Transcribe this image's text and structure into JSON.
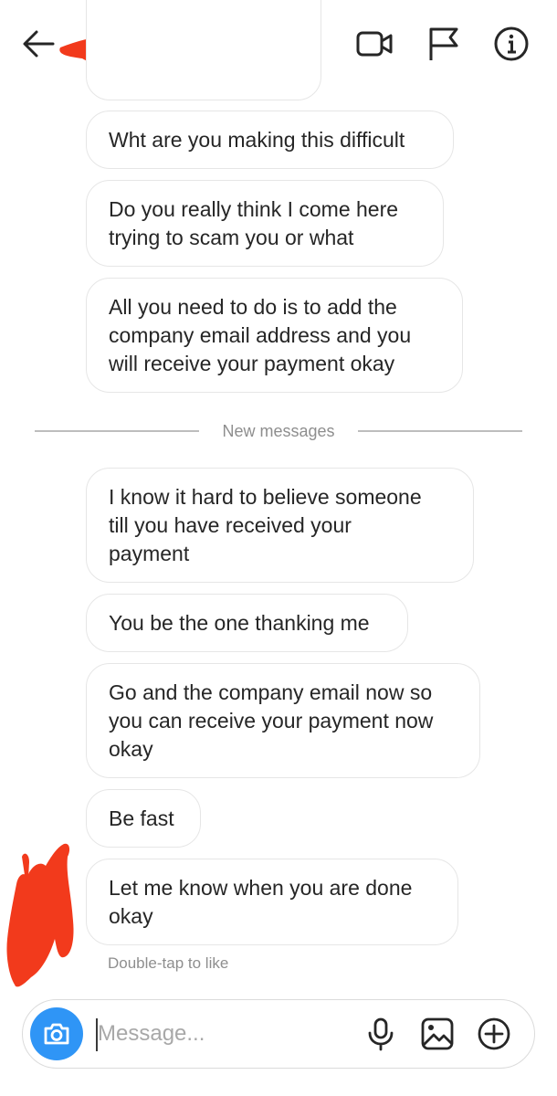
{
  "conversation": {
    "messages": [
      "Wht are you making this difficult",
      "Do you really think I come here\ntrying to scam you or what",
      "All you need to do is to add the\ncompany email address and you\nwill receive your payment okay",
      "I know it hard to believe someone\ntill you have received your\npayment",
      "You be the one thanking me",
      "Go and the company email now so\nyou can receive your payment now\nokay",
      "Be fast",
      "Let me know when you are done\nokay"
    ],
    "divider_label": "New messages",
    "double_tap_hint": "Double-tap to like"
  },
  "composer": {
    "placeholder": "Message..."
  },
  "icons": {
    "header": [
      "back-arrow-icon",
      "video-call-icon",
      "flag-icon",
      "info-icon"
    ],
    "composer": [
      "camera-icon",
      "microphone-icon",
      "gallery-icon",
      "add-icon"
    ]
  },
  "colors": {
    "redaction": "#f23a1c",
    "camera_button": "#2f95f6",
    "bubble_border": "#e6e6e6"
  }
}
